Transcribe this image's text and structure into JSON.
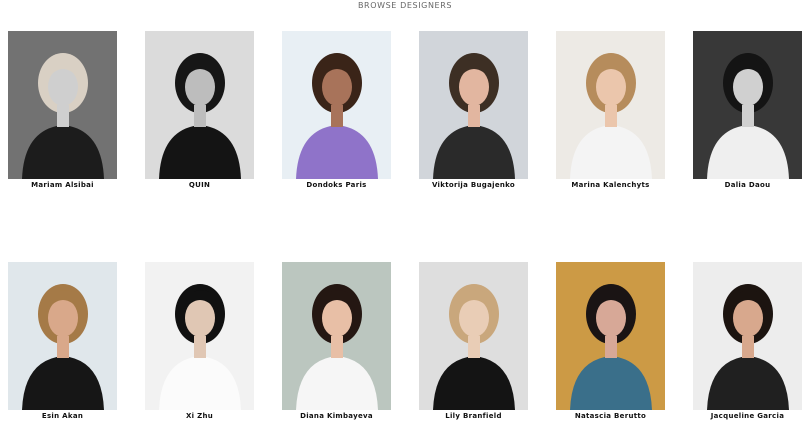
{
  "page": {
    "heading": "BROWSE DESIGNERS"
  },
  "designers": [
    {
      "name": "Mariam Alsibai",
      "photo": {
        "bg": "#7a7a7a",
        "hair": "#d9d0c4",
        "skin": "#cfcfcf",
        "top": "#1c1c1c",
        "mono": true
      }
    },
    {
      "name": "QUIN",
      "photo": {
        "bg": "#e9e9e9",
        "hair": "#161616",
        "skin": "#bdbdbd",
        "top": "#141414",
        "mono": true
      }
    },
    {
      "name": "Dondoks Paris",
      "photo": {
        "bg": "#e7eef4",
        "hair": "#3a2418",
        "skin": "#a8735a",
        "top": "#8f73c9",
        "mono": false
      }
    },
    {
      "name": "Viktorija Bugajenko",
      "photo": {
        "bg": "#cfd3d8",
        "hair": "#3d2f24",
        "skin": "#e2b6a0",
        "top": "#2a2a2a",
        "mono": false
      }
    },
    {
      "name": "Marina Kalenchyts",
      "photo": {
        "bg": "#ece9e4",
        "hair": "#b68c5c",
        "skin": "#ebc6ac",
        "top": "#f4f4f4",
        "mono": false
      }
    },
    {
      "name": "Dalia Daou",
      "photo": {
        "bg": "#3c3c3c",
        "hair": "#141414",
        "skin": "#d0d0d0",
        "top": "#efefef",
        "mono": true
      }
    },
    {
      "name": "Esin Akan",
      "photo": {
        "bg": "#dfe6ea",
        "hair": "#a57a47",
        "skin": "#d9a88a",
        "top": "#161616",
        "mono": false
      }
    },
    {
      "name": "Xi Zhu",
      "photo": {
        "bg": "#f2f2f2",
        "hair": "#111111",
        "skin": "#e0c7b4",
        "top": "#fbfbfb",
        "mono": false
      }
    },
    {
      "name": "Diana Kimbayeva",
      "photo": {
        "bg": "#b7c3bb",
        "hair": "#241712",
        "skin": "#e8bfa6",
        "top": "#f6f6f6",
        "mono": false
      }
    },
    {
      "name": "Lily Branfield",
      "photo": {
        "bg": "#dcdcdc",
        "hair": "#c9a77c",
        "skin": "#e9cdb6",
        "top": "#141414",
        "mono": false
      }
    },
    {
      "name": "Natascia Berutto",
      "photo": {
        "bg": "#c9943a",
        "hair": "#1a1414",
        "skin": "#d7a897",
        "top": "#3a6f8a",
        "mono": false
      }
    },
    {
      "name": "Jacqueline Garcia",
      "photo": {
        "bg": "#ececec",
        "hair": "#1c1410",
        "skin": "#d8a88d",
        "top": "#202020",
        "mono": false
      }
    }
  ]
}
